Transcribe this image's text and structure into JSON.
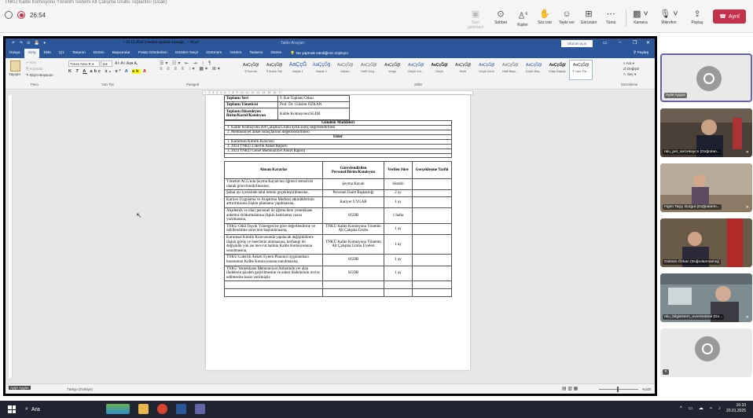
{
  "window_title": "TNKÜ Kalite Komisyonu Yönetim Sistemi Alt Çalışma Grubu Toplantısı (Ücak)",
  "meeting": {
    "timer": "26:54"
  },
  "toolbar": {
    "buttons": [
      {
        "label": "Sesi gelirmesi",
        "icon": "photo-icon",
        "disabled": true
      },
      {
        "label": "Sohbet",
        "icon": "chat-icon"
      },
      {
        "label": "Kişiler",
        "icon": "people-icon",
        "count": "6"
      },
      {
        "label": "Söz iste",
        "icon": "raise-hand-icon"
      },
      {
        "label": "Tepki ver",
        "icon": "react-icon"
      },
      {
        "label": "Görünüm",
        "icon": "grid-icon"
      },
      {
        "label": "Tümü",
        "icon": "more-icon"
      },
      {
        "label": "Kamera",
        "icon": "camera-off-icon"
      },
      {
        "label": "Mikrofon",
        "icon": "mic-off-icon"
      },
      {
        "label": "Paylaş",
        "icon": "share-icon"
      }
    ],
    "leave_label": "Ayrıl"
  },
  "word": {
    "quick_access": "↶ ↷ ⊙ 💾 ▾",
    "doc_title": "• 16.12.2024 yönetim toplantı tutanağı... • Word",
    "context": "Tablo Araçları",
    "signin": "Oturum açın",
    "tabs": [
      "Dosya",
      "Giriş",
      "Ekle",
      "Çiz",
      "Tasarım",
      "Düzen",
      "Başvurular",
      "Posta Gönderileri",
      "Gözden Geçir",
      "Görünüm",
      "Yardım",
      "Tasarım",
      "Düzen"
    ],
    "active_tab": "Giriş",
    "tell_me": "Ne yapmak istediğinizi söyleyin",
    "share": "Paylaş",
    "clipboard": {
      "paste": "Yapıştır",
      "cut": "Kes",
      "copy": "Kopyala",
      "painter": "Biçim Boyacısı",
      "group": "Pano"
    },
    "font": {
      "name": "Times New R",
      "size": "11",
      "group": "Yazı Tipi"
    },
    "paragraph_group": "Paragraf",
    "styles": [
      {
        "sample": "AaÇçĞğl",
        "name": "¶ Normal",
        "selected": false
      },
      {
        "sample": "AaÇçĞğl",
        "name": "¶ Aralık Yok",
        "selected": false
      },
      {
        "sample": "AaÇçĞ",
        "name": "Başlık 1",
        "selected": false
      },
      {
        "sample": "AaÇçĞğ",
        "name": "Başlık 2",
        "selected": false
      },
      {
        "sample": "AaÇçĞğl",
        "name": "Altyazı",
        "selected": false
      },
      {
        "sample": "AaÇçĞğl",
        "name": "Hafif Vurg...",
        "selected": false
      },
      {
        "sample": "AaÇçĞğl",
        "name": "Vurgu",
        "selected": false
      },
      {
        "sample": "AaÇçĞğl",
        "name": "Güçlü Vur...",
        "selected": false
      },
      {
        "sample": "AaÇçĞğl",
        "name": "Güçlü",
        "selected": false
      },
      {
        "sample": "AaÇçĞğl",
        "name": "Alıntı",
        "selected": false
      },
      {
        "sample": "AaÇçĞğl",
        "name": "Güçlü Alıntı",
        "selected": false
      },
      {
        "sample": "AaÇçĞğl",
        "name": "Hafif Başv...",
        "selected": false
      },
      {
        "sample": "AaÇçĞğl",
        "name": "Güçlü Baş...",
        "selected": false
      },
      {
        "sample": "AaÇçĞğl",
        "name": "Kitap Başlığı",
        "selected": false
      },
      {
        "sample": "AaÇçĞğl",
        "name": "¶ Liste Par...",
        "selected": true
      }
    ],
    "styles_group": "Stiller",
    "editing": {
      "find": "Ara",
      "replace": "Değiştir",
      "select": "Seç",
      "group": "Düzenleme"
    },
    "status": {
      "lang": "Türkçe (Türkiye)",
      "zoom": "%100"
    }
  },
  "document": {
    "info": [
      {
        "k": "Toplantı Yeri",
        "v": "9. Kat Toplantı Odası"
      },
      {
        "k": "Toplantı Yöneticisi",
        "v": "Prof. Dr. Gülsüm ÖZKAN"
      },
      {
        "k": "Toplantı Düzenleyen Birim/Kurul/Komisyon",
        "v": "Kalite Komisyonu/SGDB"
      }
    ],
    "agenda_title": "Gündem Maddeleri",
    "agenda": [
      "1.   Kalite Komisyonu Alt Çalışma Grubu aylık süreç değerlendirmesi",
      "2.   Memnuniyet anket sonuçlarının değerlendirilmesi"
    ],
    "attachments_title": "Ekler",
    "attachments": [
      "1.   Kurumsal Kimlik Kılavuzu",
      "2.   2024 TNKÜ Liderlik Anket Raporu",
      "3.   2024 TNKÜ Genel Memnuniyet Anket Raporu"
    ],
    "decisions_header": {
      "c1": "Alınan Kararlar",
      "c2": "Görevlendirilen Personel/Birim/Komisyon",
      "c3": "Verilen Süre",
      "c4": "Gerçekleşme Tarihi"
    },
    "decisions": [
      {
        "d": "Yönetim ACG'nda Şeyma Kayalı'nın öğrenci temsilcisi olarak görevlendirilmesine,",
        "who": "Şeyma Kayalı",
        "t": "Sürekli"
      },
      {
        "d": "Şubat ayı içerisinde tahıl temmi geçekleştirilmesine,",
        "who": "Personel Daire Başkanlığı",
        "t": "2 ay"
      },
      {
        "d": "Kariyer Uygulama ve Araştırma Merkezi etkinliklerinin arttırılmasına ilişkin planlama yapılmasına,",
        "who": "Kariyer UYGAR",
        "t": "1 ay"
      },
      {
        "d": "Akademik ve idari personel ile öğrencilere yemekhane anketini doldurmalarına ilişkin hatırlatma yazısı yazılmasına,",
        "who": "SGDB",
        "t": "1 hafta"
      },
      {
        "d": "TNKÜ Ödül Teşvik Yönergesi'ne göre değerlendirme ve ödüllendirme sürecinin başlatılmasına,",
        "who": "TNKÜ Kalite Komisyonu Yönetim Alt Çalışma Grubu",
        "t": "1 ay"
      },
      {
        "d": "Kurumsal Kimlik Kılavuzunda yapılacak değişikliklere ilişkin görüş ve önerilerin alınmasına, herhangi bir değişiklik yok ise mevcut halinin Kalite Komisyonuna sunulmasına,",
        "who": "TNKÜ Kalite Komisyonu Yönetim Alt Çalışma Grubu Üyeleri",
        "t": "1 ay"
      },
      {
        "d": "TNKÜ Liderlik Anketi Eylem Planının uygulanması hususunun Kalite Komisyonuna sunulmasına,",
        "who": "SGDB",
        "t": "1 ay"
      },
      {
        "d": "TNKÜ Yemekhane Memnuniyet Anketinde yer alan ifadelerin gözden geçirilmesine ve anket ifadelerinin revize edilmesine karar verilmiştir.",
        "who": "SGDB",
        "t": "1 ay"
      }
    ]
  },
  "presenter_label": "Ayşe Aygün",
  "participants": [
    {
      "name": "Ayse Aygun",
      "avatar": true
    },
    {
      "name": "nku_per_sercekaycn (Doğrulan...",
      "avatar": false
    },
    {
      "name": "Figen Taşçı Durgut (Doğrulanm...",
      "avatar": false
    },
    {
      "name": "Gülsüm Özkan (Doğrulanmamış)",
      "avatar": false
    },
    {
      "name": "nku_bilgisistem_evrenkoksal (Do...",
      "avatar": false
    },
    {
      "name": "",
      "avatar": true
    }
  ],
  "taskbar": {
    "search": "Ara",
    "time": "16:10",
    "date": "20.01.2025"
  },
  "colors": {
    "word_blue": "#2b579a",
    "leave_red": "#c4314b",
    "teams_purple": "#6264a7"
  }
}
